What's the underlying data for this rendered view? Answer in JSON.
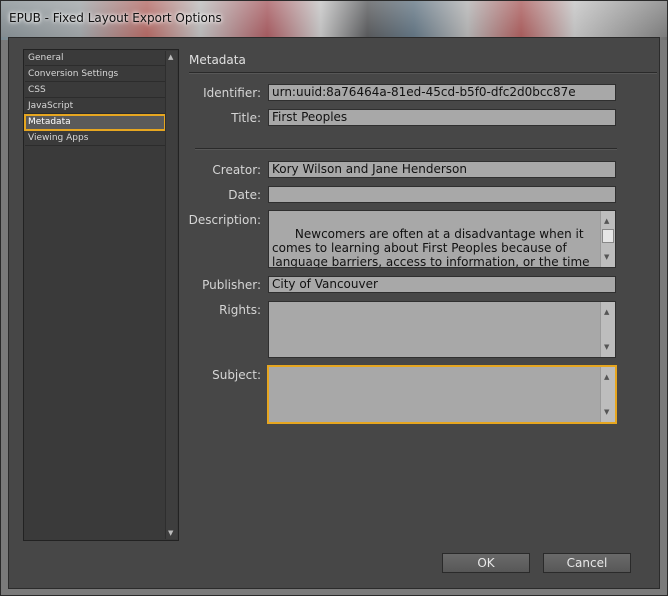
{
  "window": {
    "title": "EPUB - Fixed Layout Export Options"
  },
  "nav": {
    "items": [
      {
        "label": "General"
      },
      {
        "label": "Conversion Settings"
      },
      {
        "label": "CSS"
      },
      {
        "label": "JavaScript"
      },
      {
        "label": "Metadata",
        "selected": true
      },
      {
        "label": "Viewing Apps"
      }
    ]
  },
  "panel": {
    "title": "Metadata"
  },
  "form": {
    "identifier": {
      "label": "Identifier:",
      "value": "urn:uuid:8a76464a-81ed-45cd-b5f0-dfc2d0bcc87e"
    },
    "title": {
      "label": "Title:",
      "value": "First Peoples"
    },
    "creator": {
      "label": "Creator:",
      "value": "Kory Wilson and Jane Henderson"
    },
    "date": {
      "label": "Date:",
      "value": ""
    },
    "description": {
      "label": "Description:",
      "value": "Newcomers are often at a disadvantage when it comes to learning about First Peoples because of language barriers, access to information, or the time to learn.\nThis guide provides information about the rich culture,"
    },
    "publisher": {
      "label": "Publisher:",
      "value": "City of Vancouver"
    },
    "rights": {
      "label": "Rights:",
      "value": ""
    },
    "subject": {
      "label": "Subject:",
      "value": ""
    }
  },
  "buttons": {
    "ok": "OK",
    "cancel": "Cancel"
  },
  "colors": {
    "accent": "#e6a620",
    "panel": "#474747",
    "field": "#a8a8a8"
  }
}
